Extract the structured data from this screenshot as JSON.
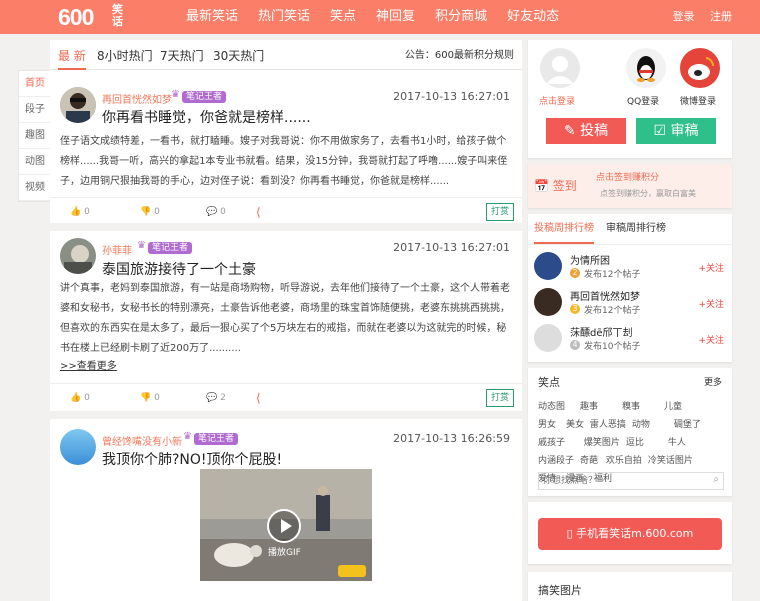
{
  "header": {
    "logo_text": "600",
    "logo_sub": "笑话",
    "nav": [
      "最新笑话",
      "热门笑话",
      "笑点",
      "神回复",
      "积分商城",
      "好友动态"
    ],
    "login": "登录",
    "register": "注册"
  },
  "sidenav": [
    "首页",
    "段子",
    "趣图",
    "动图",
    "视频"
  ],
  "tabs": [
    "最 新",
    "8小时热门",
    "7天热门",
    "30天热门"
  ],
  "notice": "公告：600最新积分规则",
  "posts": [
    {
      "author": "再回首恍然如梦",
      "badge": "笔记王者",
      "time": "2017-10-13 16:27:01",
      "title": "你再看书睡觉，你爸就是榜样......",
      "body": "侄子语文成绩特差，一看书，就打瞌睡。嫂子对我哥说：你不用做家务了，去看书1小时，给孩子做个榜样......我哥一听，高兴的拿起1本专业书就看。结果，没15分钟，我哥就打起了呼噜......嫂子叫来侄子，边用铜尺狠抽我哥的手心，边对侄子说：看到没？你再看书睡觉，你爸就是榜样......",
      "likes": "0",
      "dislikes": "0",
      "comments": "0",
      "reward": "打赏"
    },
    {
      "author": "孙菲菲",
      "badge": "笔记王者",
      "time": "2017-10-13 16:27:01",
      "title": "泰国旅游接待了一个土豪",
      "body": "讲个真事，老妈到泰国旅游，有一站是商场购物，听导游说，去年他们接待了一个土豪，这个人带着老婆和女秘书，女秘书长的特别漂亮，土豪告诉他老婆，商场里的珠宝首饰随便挑，老婆东挑挑西挑挑，但喜欢的东西实在是太多了，最后一狠心买了个5万块左右的戒指，而就在老婆以为这就完的时候，秘书在楼上已经刷卡刷了近200万了..........",
      "more": ">>查看更多",
      "likes": "0",
      "dislikes": "0",
      "comments": "2",
      "reward": "打赏"
    },
    {
      "author": "曾经馋嘴没有小新",
      "badge": "笔记王者",
      "time": "2017-10-13 16:26:59",
      "title": "我顶你个肺?NO!顶你个屁股!",
      "gif_label": "播放GIF"
    }
  ],
  "right": {
    "click_login": "点击登录",
    "qq_login": "QQ登录",
    "weibo_login": "微博登录",
    "submit": "投稿",
    "review": "审稿",
    "checkin": "签到",
    "checkin_title": "点击签到赚积分",
    "checkin_desc": "点签到赚积分，赢取白富美",
    "rank_tabs": [
      "投稿周排行榜",
      "审稿周排行榜"
    ],
    "users": [
      {
        "name": "为情所困",
        "rank": "2",
        "posts": "发布12个帖子",
        "follow": "+关注"
      },
      {
        "name": "再回首恍然如梦",
        "rank": "3",
        "posts": "发布12个帖子",
        "follow": "+关注"
      },
      {
        "name": "莯醥dē邤丅刦",
        "rank": "4",
        "posts": "发布10个帖子",
        "follow": "+关注"
      }
    ],
    "tags_title": "笑点",
    "tags_more": "更多",
    "tags": [
      "动态图",
      "趣事",
      "糗事",
      "儿童",
      "男女",
      "美女",
      "雷人恶搞",
      "动物",
      "碉堡了",
      "戚孩子",
      "爆笑图片",
      "逗比",
      "牛人",
      "内涵段子",
      "奇葩",
      "欢乐自拍",
      "冷笑话图片",
      "爱情",
      "漫画",
      "福利"
    ],
    "search_placeholder": "你想找点啥？",
    "mobile_btn": "手机看笑话m.600.com",
    "pics_title": "搞笑图片"
  },
  "colors": {
    "brand": "#fb7e68",
    "green": "#2fbf8a",
    "red": "#f25a56"
  }
}
